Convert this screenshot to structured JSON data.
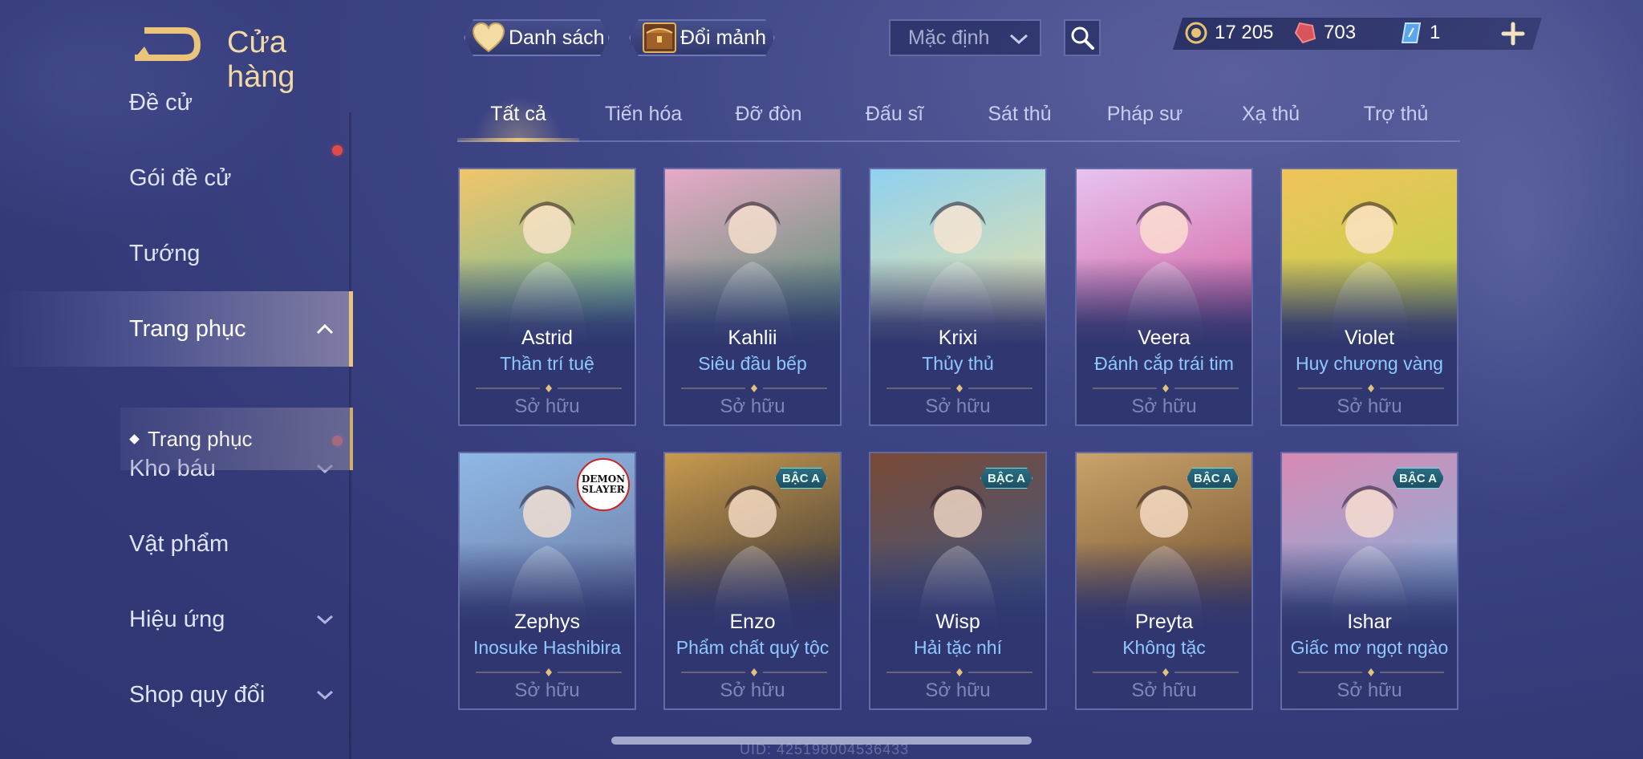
{
  "header": {
    "title": "Cửa hàng",
    "wishlist_label": "Danh sách",
    "exchange_label": "Đổi mảnh",
    "sort_value": "Mặc định",
    "currencies": [
      {
        "name": "gold",
        "value": "17 205",
        "color": "#e6c270"
      },
      {
        "name": "voucher",
        "value": "703",
        "color": "#d9545a"
      },
      {
        "name": "ticket",
        "value": "1",
        "color": "#7fc4ff"
      }
    ]
  },
  "sidebar": {
    "items": [
      {
        "label": "Đề cử",
        "has_dot": false,
        "expandable": false
      },
      {
        "label": "Gói đề cử",
        "has_dot": true,
        "expandable": false
      },
      {
        "label": "Tướng",
        "has_dot": false,
        "expandable": false
      },
      {
        "label": "Trang phục",
        "has_dot": false,
        "expandable": true,
        "active": true
      },
      {
        "label": "Kho báu",
        "has_dot": true,
        "expandable": true
      },
      {
        "label": "Vật phẩm",
        "has_dot": false,
        "expandable": false
      },
      {
        "label": "Hiệu ứng",
        "has_dot": false,
        "expandable": true
      },
      {
        "label": "Shop quy đổi",
        "has_dot": false,
        "expandable": true
      }
    ],
    "subitem": "Trang phục"
  },
  "tabs": [
    "Tất cả",
    "Tiến hóa",
    "Đỡ đòn",
    "Đấu sĩ",
    "Sát thủ",
    "Pháp sư",
    "Xạ thủ",
    "Trợ thủ"
  ],
  "active_tab": "Tất cả",
  "cards": [
    {
      "hero": "Astrid",
      "skin": "Thần trí tuệ",
      "status": "Sở hữu",
      "badge": "",
      "palette": [
        "#f2c46a",
        "#5fbfa0"
      ]
    },
    {
      "hero": "Kahlii",
      "skin": "Siêu đầu bếp",
      "status": "Sở hữu",
      "badge": "",
      "palette": [
        "#e8a9c8",
        "#4a8f6a"
      ]
    },
    {
      "hero": "Krixi",
      "skin": "Thủy thủ",
      "status": "Sở hữu",
      "badge": "",
      "palette": [
        "#8fd0ef",
        "#f1e3a0"
      ]
    },
    {
      "hero": "Veera",
      "skin": "Đánh cắp trái tim",
      "status": "Sở hữu",
      "badge": "",
      "palette": [
        "#e6c3ef",
        "#d35a9a"
      ]
    },
    {
      "hero": "Violet",
      "skin": "Huy chương vàng",
      "status": "Sở hữu",
      "badge": "",
      "palette": [
        "#f0c35a",
        "#b7d44a"
      ]
    },
    {
      "hero": "Zephys",
      "skin": "Inosuke Hashibira",
      "status": "Sở hữu",
      "badge": "",
      "collab": [
        "DEMON",
        "SLAYER"
      ],
      "palette": [
        "#8fb8e6",
        "#6a7aa0"
      ]
    },
    {
      "hero": "Enzo",
      "skin": "Phẩm chất quý tộc",
      "status": "Sở hữu",
      "badge": "BẬC A",
      "palette": [
        "#c99a4e",
        "#2c2c34"
      ]
    },
    {
      "hero": "Wisp",
      "skin": "Hải tặc nhí",
      "status": "Sở hữu",
      "badge": "BẬC A",
      "palette": [
        "#7a4a36",
        "#3a5a8a"
      ]
    },
    {
      "hero": "Preyta",
      "skin": "Không tặc",
      "status": "Sở hữu",
      "badge": "BẬC A",
      "palette": [
        "#caa36a",
        "#6b4a2a"
      ]
    },
    {
      "hero": "Ishar",
      "skin": "Giấc mơ ngọt ngào",
      "status": "Sở hữu",
      "badge": "BẬC A",
      "palette": [
        "#d889b4",
        "#7cb7df"
      ]
    }
  ],
  "footer": {
    "uid": "UID: 425198004536433"
  }
}
